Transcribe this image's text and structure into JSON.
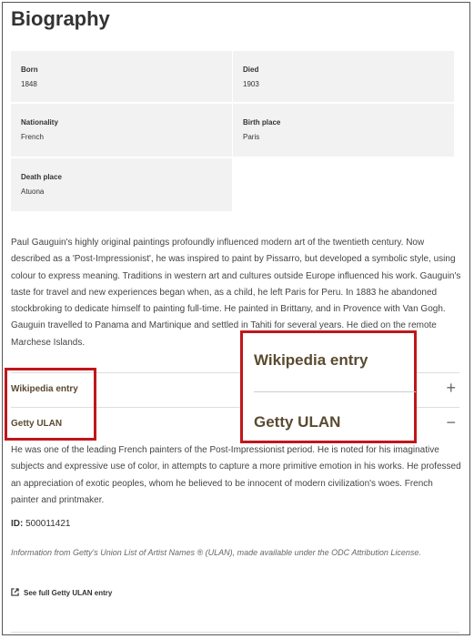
{
  "page_title": "Biography",
  "facts": {
    "born": {
      "label": "Born",
      "value": "1848"
    },
    "died": {
      "label": "Died",
      "value": "1903"
    },
    "nationality": {
      "label": "Nationality",
      "value": "French"
    },
    "birth_place": {
      "label": "Birth place",
      "value": "Paris"
    },
    "death_place": {
      "label": "Death place",
      "value": "Atuona"
    }
  },
  "bio_text": "Paul Gauguin's highly original paintings profoundly influenced modern art of the twentieth century. Now described as a 'Post-Impressionist', he was inspired to paint by Pissarro, but developed a symbolic style, using colour to express meaning. Traditions in western art and cultures outside Europe influenced his work. Gauguin's taste for travel and new experiences began when, as a child, he left Paris for Peru. In 1883 he abandoned stockbroking to dedicate himself to painting full-time. He painted in Brittany, and in Provence with Van Gogh. Gauguin travelled to Panama and Martinique and settled in Tahiti for several years. He died on the remote Marchese Islands.",
  "accordion": {
    "wikipedia": {
      "label": "Wikipedia entry",
      "icon": "+"
    },
    "getty": {
      "label": "Getty ULAN",
      "icon": "−"
    }
  },
  "getty": {
    "description": "He was one of the leading French painters of the Post-Impressionist period. He is noted for his imaginative subjects and expressive use of color, in attempts to capture a more primitive emotion in his works. He professed an appreciation of exotic peoples, whom he believed to be innocent of modern civilization's woes. French painter and printmaker.",
    "id_label": "ID:",
    "id_value": "500011421",
    "credit": "Information from Getty's Union List of Artist Names ® (ULAN), made available under the ODC Attribution License.",
    "full_link": "See full Getty ULAN entry",
    "link_icon": "external-link-icon"
  },
  "zoom_callout": {
    "wikipedia_label": "Wikipedia entry",
    "getty_label": "Getty ULAN"
  },
  "colors": {
    "highlight": "#c0161b",
    "accordion_label": "#5a4a30"
  }
}
